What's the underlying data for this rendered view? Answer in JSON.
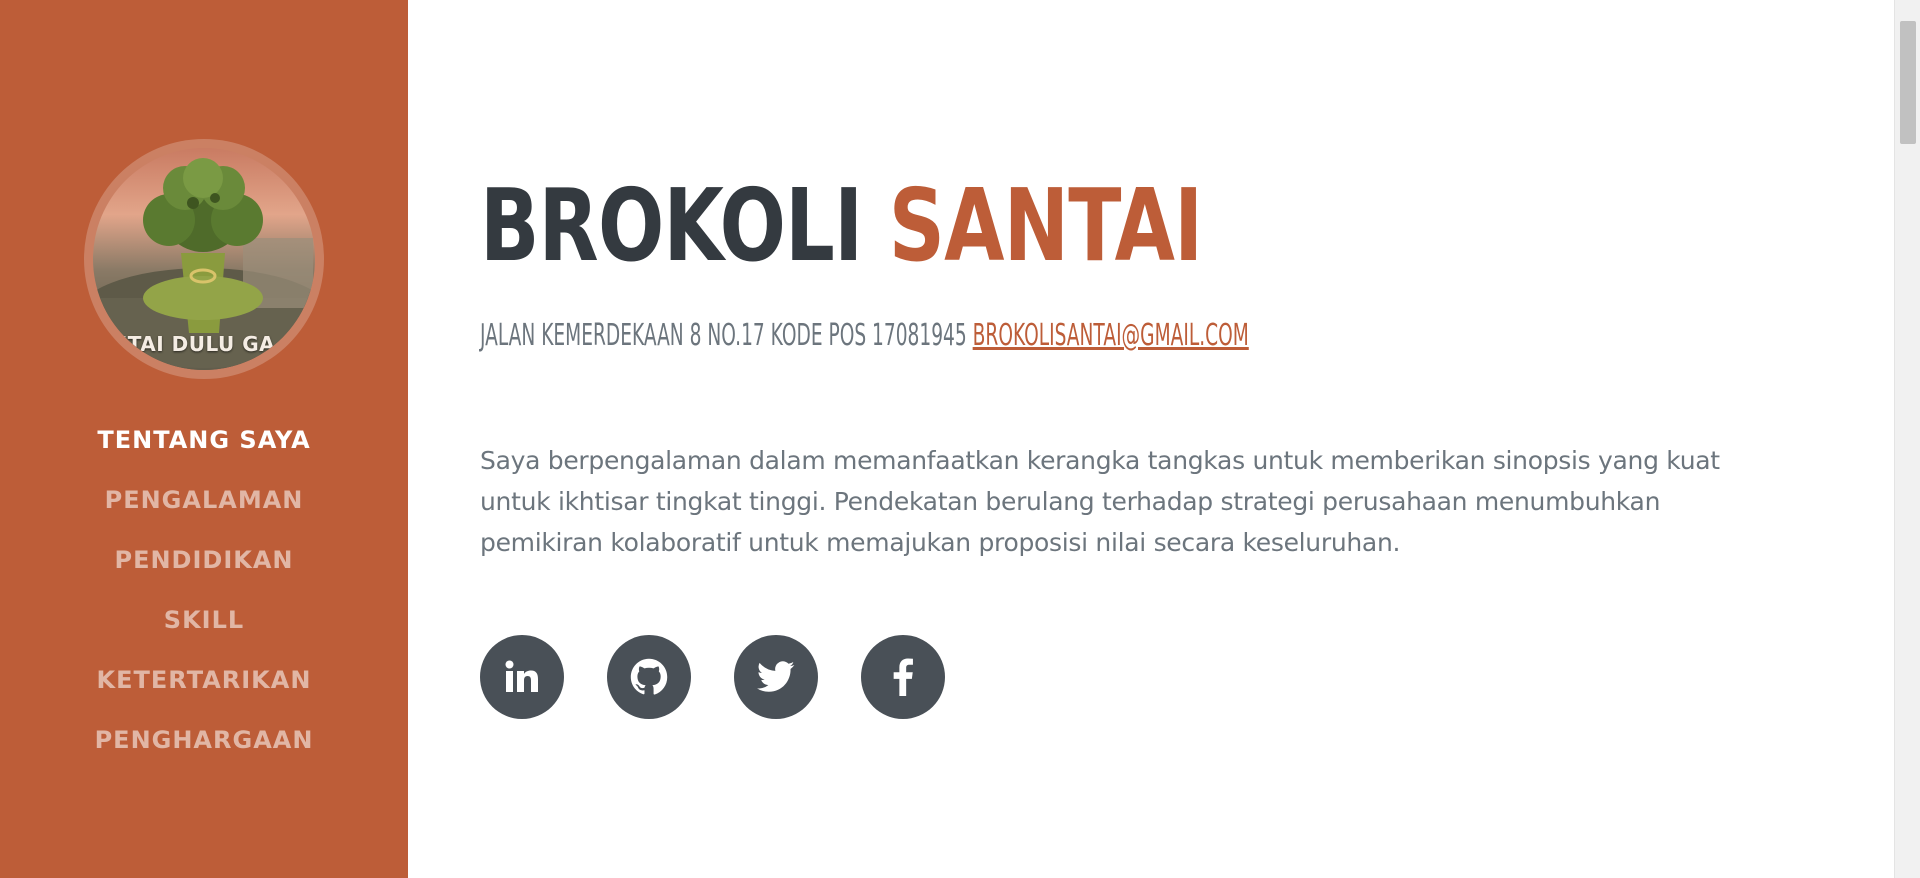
{
  "profile": {
    "avatar_caption": "NTAI DULU GA S",
    "first_name": "BROKOLI",
    "last_name": "SANTAI",
    "address": "JALAN KEMERDEKAAN 8 NO.17 KODE POS 17081945",
    "email": "BROKOLISANTAI@GMAIL.COM",
    "about": "Saya berpengalaman dalam memanfaatkan kerangka tangkas untuk memberikan sinopsis yang kuat untuk ikhtisar tingkat tinggi. Pendekatan berulang terhadap strategi perusahaan menumbuhkan pemikiran kolaboratif untuk memajukan proposisi nilai secara keseluruhan."
  },
  "nav": {
    "items": [
      {
        "label": "TENTANG SAYA",
        "active": true
      },
      {
        "label": "PENGALAMAN"
      },
      {
        "label": "PENDIDIKAN"
      },
      {
        "label": "SKILL"
      },
      {
        "label": "KETERTARIKAN"
      },
      {
        "label": "PENGHARGAAN"
      }
    ]
  },
  "socials": [
    {
      "icon": "linkedin-icon"
    },
    {
      "icon": "github-icon"
    },
    {
      "icon": "twitter-icon"
    },
    {
      "icon": "facebook-icon"
    }
  ],
  "colors": {
    "primary": "#bd5d38",
    "dark": "#343a40",
    "muted": "#6c757d",
    "social_bg": "#495057"
  }
}
